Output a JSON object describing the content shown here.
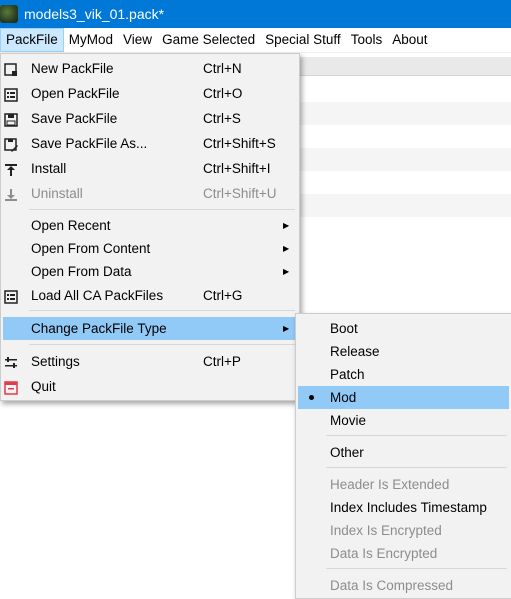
{
  "window": {
    "title": "models3_vik_01.pack*"
  },
  "menubar": {
    "items": [
      {
        "label": "PackFile"
      },
      {
        "label": "MyMod"
      },
      {
        "label": "View"
      },
      {
        "label": "Game Selected"
      },
      {
        "label": "Special Stuff"
      },
      {
        "label": "Tools"
      },
      {
        "label": "About"
      }
    ]
  },
  "packfile_menu": {
    "items": [
      {
        "label": "New PackFile",
        "shortcut": "Ctrl+N",
        "icon": "new-packfile-icon"
      },
      {
        "label": "Open PackFile",
        "shortcut": "Ctrl+O",
        "icon": "open-packfile-icon"
      },
      {
        "label": "Save PackFile",
        "shortcut": "Ctrl+S",
        "icon": "save-icon"
      },
      {
        "label": "Save PackFile As...",
        "shortcut": "Ctrl+Shift+S",
        "icon": "save-as-icon"
      },
      {
        "label": "Install",
        "shortcut": "Ctrl+Shift+I",
        "icon": "install-icon"
      },
      {
        "label": "Uninstall",
        "shortcut": "Ctrl+Shift+U",
        "icon": "uninstall-icon",
        "disabled": true
      },
      {
        "label": "Open Recent",
        "submenu": true
      },
      {
        "label": "Open From Content",
        "submenu": true
      },
      {
        "label": "Open From Data",
        "submenu": true
      },
      {
        "label": "Load All CA PackFiles",
        "shortcut": "Ctrl+G",
        "icon": "load-all-icon"
      },
      {
        "label": "Change PackFile Type",
        "submenu": true,
        "highlighted": true
      },
      {
        "label": "Settings",
        "shortcut": "Ctrl+P",
        "icon": "settings-icon"
      },
      {
        "label": "Quit",
        "icon": "quit-icon"
      }
    ]
  },
  "type_submenu": {
    "items": [
      {
        "label": "Boot"
      },
      {
        "label": "Release"
      },
      {
        "label": "Patch"
      },
      {
        "label": "Mod",
        "selected": true
      },
      {
        "label": "Movie"
      },
      {
        "label": "Other"
      },
      {
        "label": "Header Is Extended",
        "disabled": true
      },
      {
        "label": "Index Includes Timestamp"
      },
      {
        "label": "Index Is Encrypted",
        "disabled": true
      },
      {
        "label": "Data Is Encrypted",
        "disabled": true
      },
      {
        "label": "Data Is Compressed",
        "disabled": true
      }
    ]
  },
  "colors": {
    "titlebar": "#0078d7",
    "highlight": "#91c9f7",
    "menu_bg": "#f2f2f2",
    "disabled_text": "#8d8d8d"
  }
}
